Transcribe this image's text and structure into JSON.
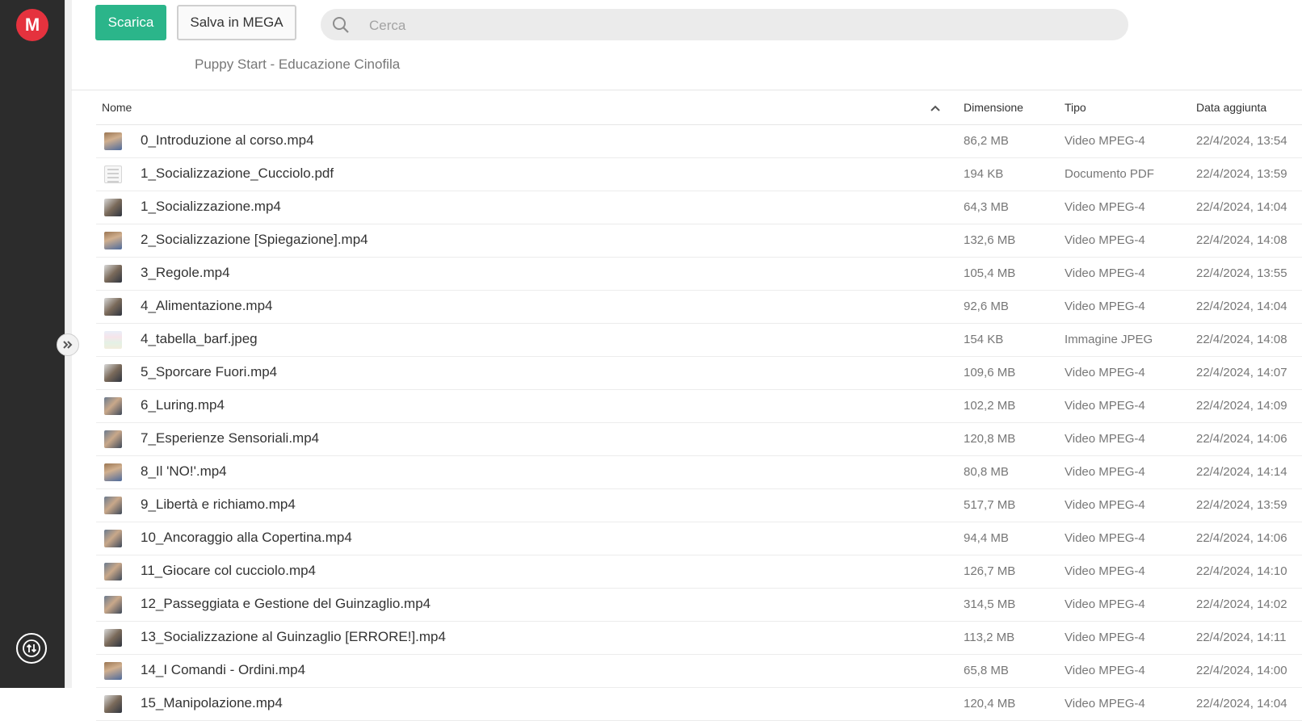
{
  "sidebar": {
    "logo_letter": "M",
    "expand_icon": "double-chevron-right",
    "transfer_icon": "upload-download-circle"
  },
  "toolbar": {
    "download_label": "Scarica",
    "save_label": "Salva in MEGA"
  },
  "search": {
    "placeholder": "Cerca",
    "value": ""
  },
  "folder": {
    "title": "Puppy Start - Educazione Cinofila"
  },
  "table": {
    "headers": {
      "name": "Nome",
      "size": "Dimensione",
      "type": "Tipo",
      "date": "Data aggiunta"
    },
    "sort": {
      "column": "Nome",
      "direction": "ascending"
    },
    "rows": [
      {
        "name": "0_Introduzione al corso.mp4",
        "size": "86,2 MB",
        "type": "Video MPEG-4",
        "date": "22/4/2024, 13:54",
        "thumb": "video-c"
      },
      {
        "name": "1_Socializzazione_Cucciolo.pdf",
        "size": "194 KB",
        "type": "Documento PDF",
        "date": "22/4/2024, 13:59",
        "thumb": "pdf"
      },
      {
        "name": "1_Socializzazione.mp4",
        "size": "64,3 MB",
        "type": "Video MPEG-4",
        "date": "22/4/2024, 14:04",
        "thumb": "video-b"
      },
      {
        "name": "2_Socializzazione [Spiegazione].mp4",
        "size": "132,6 MB",
        "type": "Video MPEG-4",
        "date": "22/4/2024, 14:08",
        "thumb": "video-c"
      },
      {
        "name": "3_Regole.mp4",
        "size": "105,4 MB",
        "type": "Video MPEG-4",
        "date": "22/4/2024, 13:55",
        "thumb": "video-b"
      },
      {
        "name": "4_Alimentazione.mp4",
        "size": "92,6 MB",
        "type": "Video MPEG-4",
        "date": "22/4/2024, 14:04",
        "thumb": "video-b"
      },
      {
        "name": "4_tabella_barf.jpeg",
        "size": "154 KB",
        "type": "Immagine JPEG",
        "date": "22/4/2024, 14:08",
        "thumb": "jpeg"
      },
      {
        "name": "5_Sporcare Fuori.mp4",
        "size": "109,6 MB",
        "type": "Video MPEG-4",
        "date": "22/4/2024, 14:07",
        "thumb": "video-b"
      },
      {
        "name": "6_Luring.mp4",
        "size": "102,2 MB",
        "type": "Video MPEG-4",
        "date": "22/4/2024, 14:09",
        "thumb": "video"
      },
      {
        "name": "7_Esperienze Sensoriali.mp4",
        "size": "120,8 MB",
        "type": "Video MPEG-4",
        "date": "22/4/2024, 14:06",
        "thumb": "video"
      },
      {
        "name": "8_Il 'NO!'.mp4",
        "size": "80,8 MB",
        "type": "Video MPEG-4",
        "date": "22/4/2024, 14:14",
        "thumb": "video-c"
      },
      {
        "name": "9_Libertà e richiamo.mp4",
        "size": "517,7 MB",
        "type": "Video MPEG-4",
        "date": "22/4/2024, 13:59",
        "thumb": "video"
      },
      {
        "name": "10_Ancoraggio alla Copertina.mp4",
        "size": "94,4 MB",
        "type": "Video MPEG-4",
        "date": "22/4/2024, 14:06",
        "thumb": "video"
      },
      {
        "name": "11_Giocare col cucciolo.mp4",
        "size": "126,7 MB",
        "type": "Video MPEG-4",
        "date": "22/4/2024, 14:10",
        "thumb": "video"
      },
      {
        "name": "12_Passeggiata e Gestione del Guinzaglio.mp4",
        "size": "314,5 MB",
        "type": "Video MPEG-4",
        "date": "22/4/2024, 14:02",
        "thumb": "video"
      },
      {
        "name": "13_Socializzazione al Guinzaglio [ERRORE!].mp4",
        "size": "113,2 MB",
        "type": "Video MPEG-4",
        "date": "22/4/2024, 14:11",
        "thumb": "video-b"
      },
      {
        "name": "14_I Comandi - Ordini.mp4",
        "size": "65,8 MB",
        "type": "Video MPEG-4",
        "date": "22/4/2024, 14:00",
        "thumb": "video-c"
      },
      {
        "name": "15_Manipolazione.mp4",
        "size": "120,4 MB",
        "type": "Video MPEG-4",
        "date": "22/4/2024, 14:04",
        "thumb": "video-b"
      }
    ]
  },
  "colors": {
    "sidebar": "#2c2c2c",
    "brand_red": "#e5323e",
    "download_green": "#2bb58a"
  }
}
